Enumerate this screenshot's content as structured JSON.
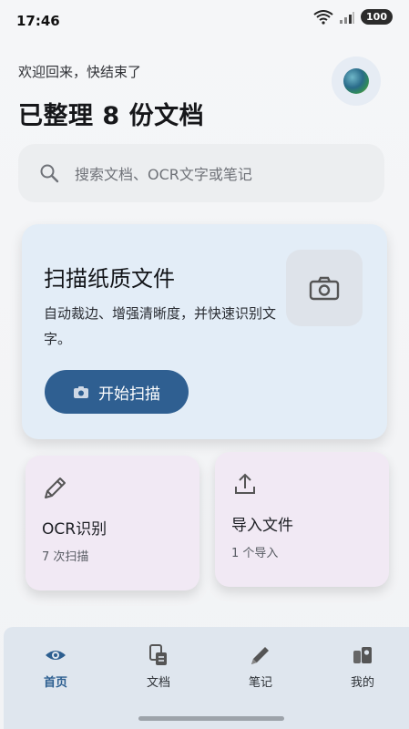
{
  "status_bar": {
    "time": "17:46",
    "battery": "100"
  },
  "header": {
    "greeting": "欢迎回来，快结束了",
    "title": "已整理 8 份文档"
  },
  "search": {
    "placeholder": "搜索文档、OCR文字或笔记"
  },
  "scan_card": {
    "title": "扫描纸质文件",
    "description": "自动裁边、增强清晰度，并快速识别文字。",
    "button_label": "开始扫描"
  },
  "cards": [
    {
      "title": "OCR识别",
      "subtitle": "7 次扫描",
      "icon": "pencil-icon"
    },
    {
      "title": "导入文件",
      "subtitle": "1 个导入",
      "icon": "upload-icon"
    }
  ],
  "bottom_nav": [
    {
      "label": "首页",
      "icon": "eye-icon",
      "active": true
    },
    {
      "label": "文档",
      "icon": "document-icon",
      "active": false
    },
    {
      "label": "笔记",
      "icon": "pen-icon",
      "active": false
    },
    {
      "label": "我的",
      "icon": "profile-icon",
      "active": false
    }
  ],
  "colors": {
    "accent": "#2f5f91",
    "scan_card_bg": "#e3edf7",
    "mini_card_bg": "#f1e9f4",
    "nav_bg": "#dfe6ee"
  }
}
